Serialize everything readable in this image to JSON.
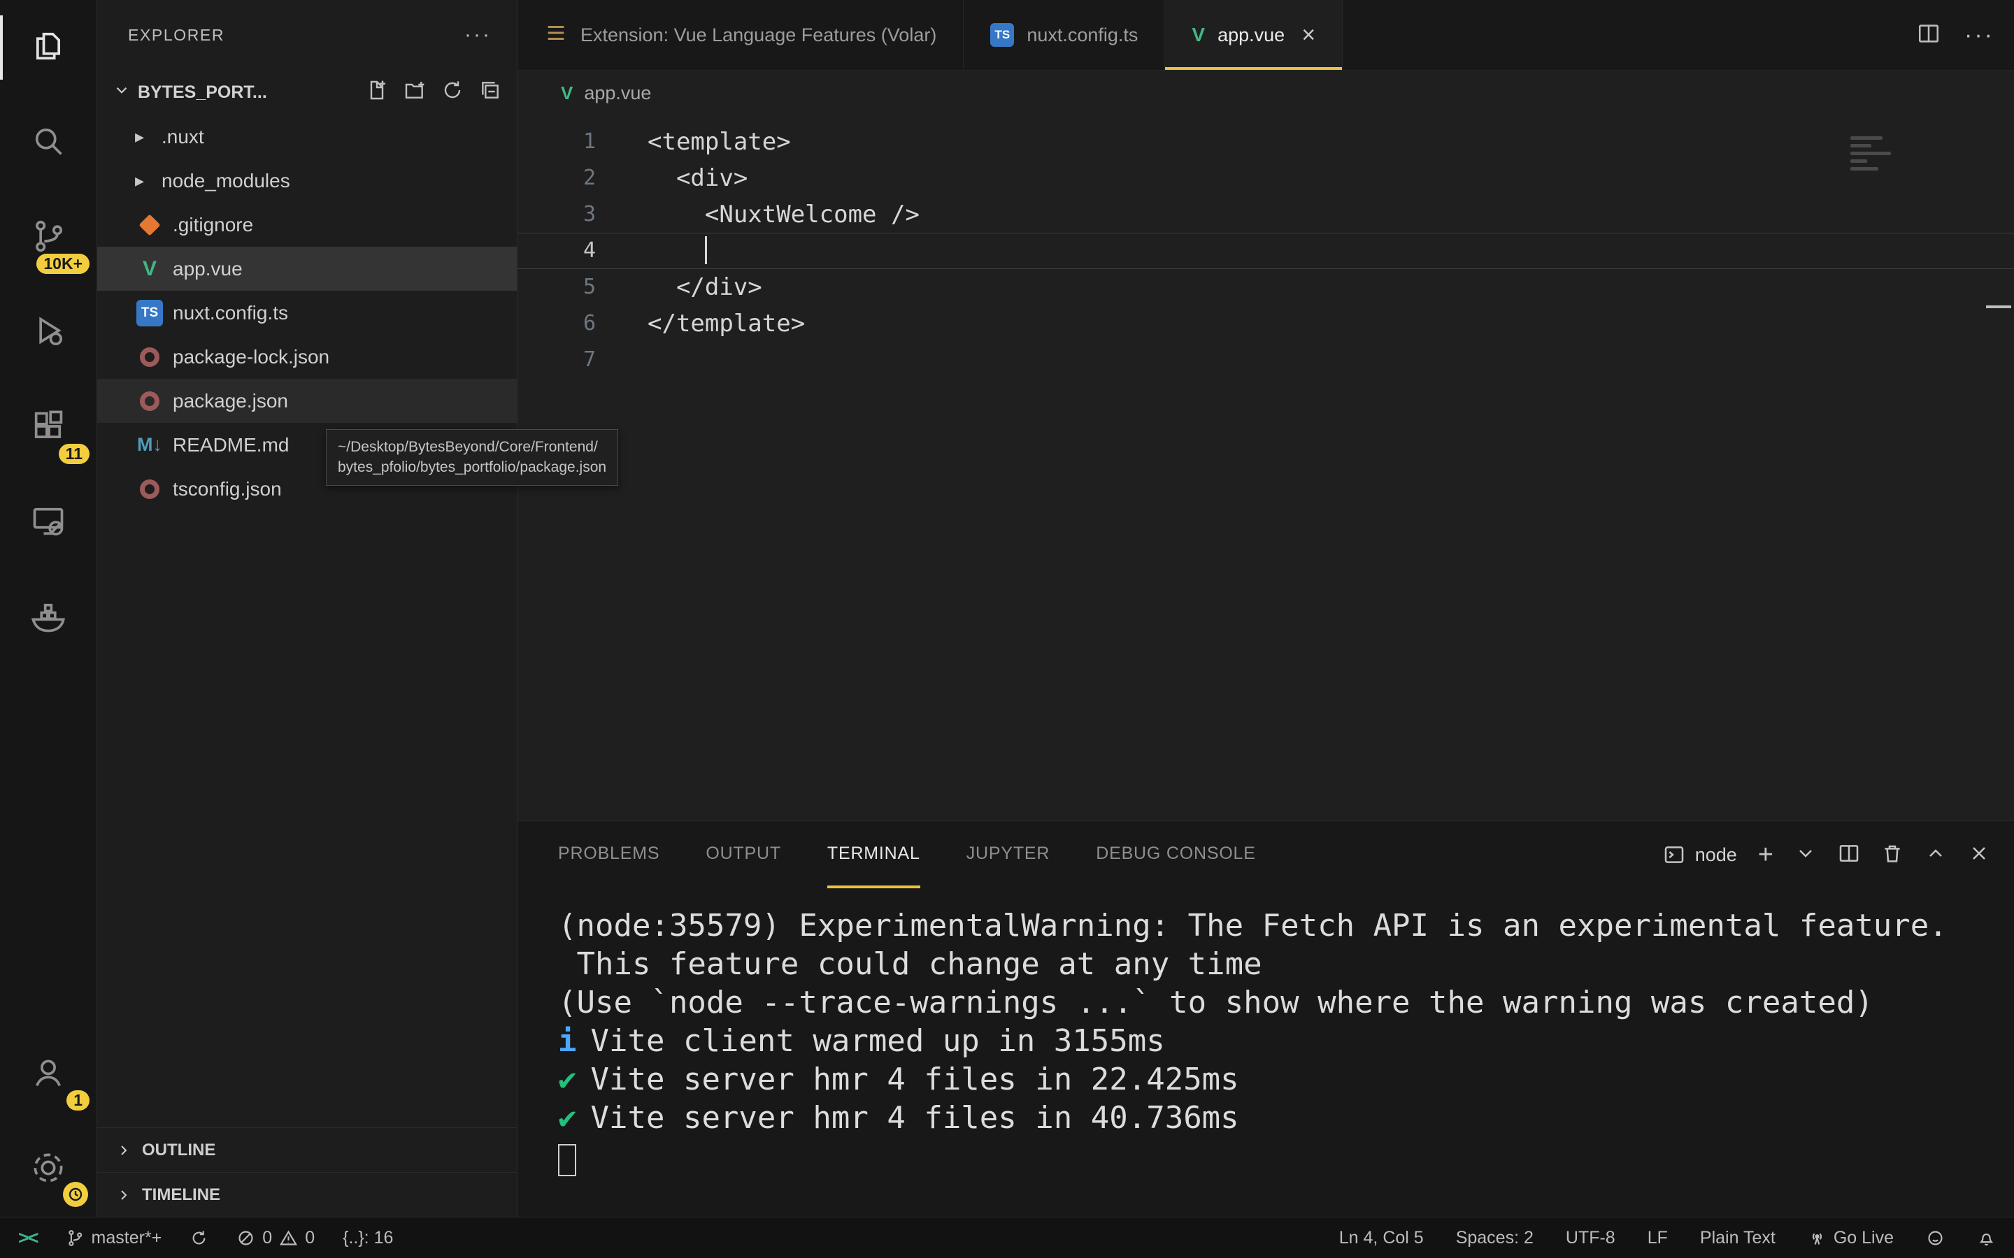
{
  "accent": "#e9c341",
  "activity_bar": {
    "badges": {
      "source_control": "10K+",
      "extensions": "11",
      "accounts": "1"
    }
  },
  "sidebar": {
    "title": "EXPLORER",
    "section_label": "BYTES_PORT...",
    "files": [
      {
        "name": ".nuxt"
      },
      {
        "name": "node_modules"
      },
      {
        "name": ".gitignore"
      },
      {
        "name": "app.vue"
      },
      {
        "name": "nuxt.config.ts"
      },
      {
        "name": "package-lock.json"
      },
      {
        "name": "package.json"
      },
      {
        "name": "README.md"
      },
      {
        "name": "tsconfig.json"
      }
    ],
    "outline_label": "OUTLINE",
    "timeline_label": "TIMELINE"
  },
  "tooltip": {
    "line1": "~/Desktop/BytesBeyond/Core/Frontend/",
    "line2": "bytes_pfolio/bytes_portfolio/package.json"
  },
  "tabs": {
    "extension_tab": "Extension: Vue Language Features (Volar)",
    "tab2": "nuxt.config.ts",
    "tab3": "app.vue"
  },
  "breadcrumb": {
    "file": "app.vue"
  },
  "editor": {
    "lines": [
      {
        "n": "1",
        "t": "<template>"
      },
      {
        "n": "2",
        "t": "  <div>"
      },
      {
        "n": "3",
        "t": "    <NuxtWelcome />"
      },
      {
        "n": "4",
        "t": "    "
      },
      {
        "n": "5",
        "t": "  </div>"
      },
      {
        "n": "6",
        "t": "</template>"
      },
      {
        "n": "7",
        "t": ""
      }
    ]
  },
  "panel": {
    "tabs": [
      "PROBLEMS",
      "OUTPUT",
      "TERMINAL",
      "JUPYTER",
      "DEBUG CONSOLE"
    ],
    "active_tab": "TERMINAL",
    "shell_label": "node",
    "terminal": {
      "lines": [
        {
          "mark": "",
          "text": "(node:35579) ExperimentalWarning: The Fetch API is an experimental feature."
        },
        {
          "mark": "",
          "text": " This feature could change at any time"
        },
        {
          "mark": "",
          "text": "(Use `node --trace-warnings ...` to show where the warning was created)"
        },
        {
          "mark": "i",
          "text": "Vite client warmed up in 3155ms"
        },
        {
          "mark": "✔",
          "text": "Vite server hmr 4 files in 22.425ms"
        },
        {
          "mark": "✔",
          "text": "Vite server hmr 4 files in 40.736ms"
        }
      ]
    }
  },
  "status_bar": {
    "branch": "master*+",
    "errors": "0",
    "warnings": "0",
    "snippet_indicator": "{..}: 16",
    "line_col": "Ln 4, Col 5",
    "indentation": "Spaces: 2",
    "encoding": "UTF-8",
    "eol": "LF",
    "language": "Plain Text",
    "go_live": "Go Live"
  }
}
